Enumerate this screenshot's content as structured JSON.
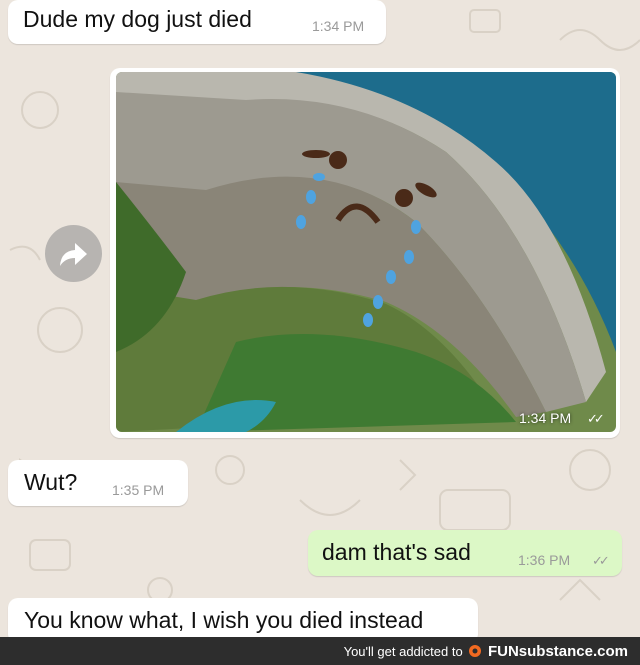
{
  "messages": [
    {
      "id": "m1",
      "direction": "in",
      "text": "Dude my dog just died",
      "time": "1:34 PM"
    },
    {
      "id": "m2",
      "direction": "in",
      "type": "image",
      "image_desc_icon": "crying-dam-photo",
      "time": "1:34 PM",
      "ticks": "✓✓"
    },
    {
      "id": "m3",
      "direction": "in",
      "text": "Wut?",
      "time": "1:35 PM"
    },
    {
      "id": "m4",
      "direction": "out",
      "text": "dam that's sad",
      "time": "1:36 PM",
      "ticks": "✓✓"
    },
    {
      "id": "m5",
      "direction": "in",
      "text": "You know what, I wish you died instead"
    }
  ],
  "forward": {
    "icon": "forward-arrow-icon"
  },
  "footer": {
    "prefix": "You'll get addicted to",
    "brand_icon": "funsubstance-logo-icon",
    "brand": "FUNsubstance.com"
  },
  "colors": {
    "chat_bg": "#ece5dd",
    "incoming_bubble": "#ffffff",
    "outgoing_bubble": "#dcf8c6",
    "timestamp": "#9a9a9a",
    "footer_bg": "#2d2d2d"
  }
}
